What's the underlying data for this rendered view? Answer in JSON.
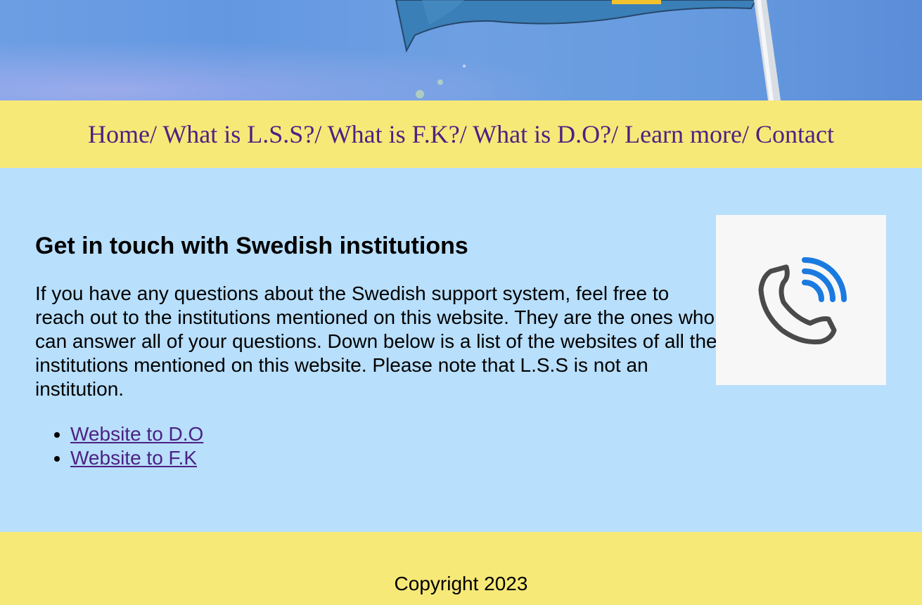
{
  "hero": {
    "image": "swedish-flag-banner"
  },
  "nav": {
    "items": [
      {
        "label": "Home"
      },
      {
        "label": "What is L.S.S?"
      },
      {
        "label": "What is F.K?"
      },
      {
        "label": "What is D.O?"
      },
      {
        "label": "Learn more"
      },
      {
        "label": "Contact"
      }
    ],
    "separator": "/ "
  },
  "main": {
    "heading": "Get in touch with Swedish institutions",
    "paragraph": "If you have any questions about the Swedish support system, feel free to reach out to the institutions mentioned on this website. They are the ones who can answer all of your questions. Down below is a list of the websites of all the institutions mentioned on this website. Please note that L.S.S is not an institution.",
    "links": [
      {
        "label": "Website to D.O"
      },
      {
        "label": "Website to F.K"
      }
    ],
    "image_icon": "phone-call-icon"
  },
  "footer": {
    "copyright": "Copyright 2023"
  },
  "colors": {
    "nav_background": "#f7e978",
    "nav_text": "#4c2283",
    "main_background": "#b8dffc",
    "accent_blue": "#1a7ae0",
    "icon_gray": "#4a4a4a"
  }
}
